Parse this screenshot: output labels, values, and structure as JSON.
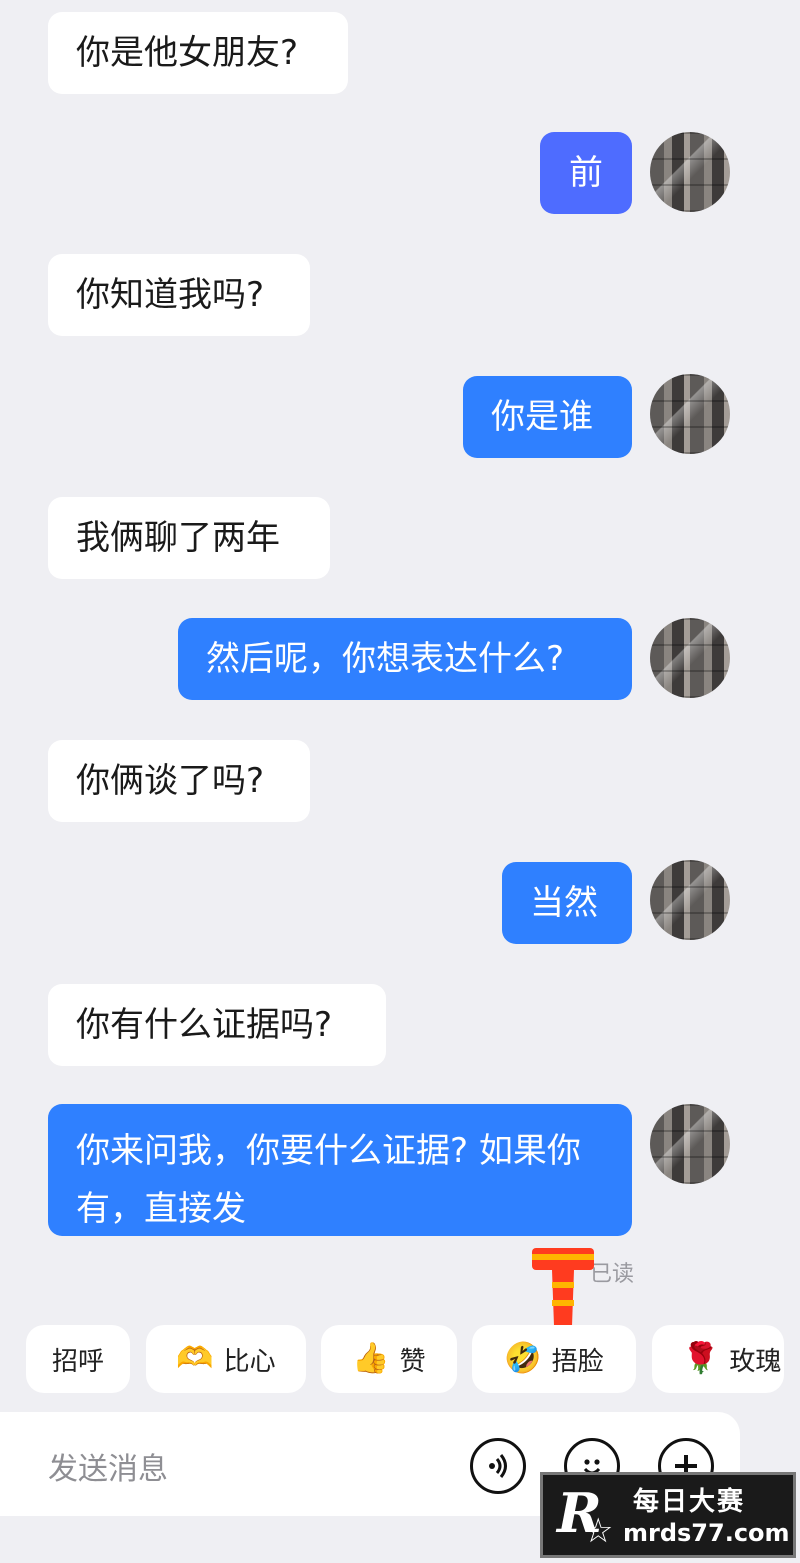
{
  "colors": {
    "background": "#efeff3",
    "incoming": "#ffffff",
    "outgoing": "#2f80ff",
    "outgoing_alt": "#4e6cff"
  },
  "messages": [
    {
      "side": "in",
      "text": "你是他女朋友?"
    },
    {
      "side": "out",
      "text": "前"
    },
    {
      "side": "in",
      "text": "你知道我吗?"
    },
    {
      "side": "out",
      "text": "你是谁"
    },
    {
      "side": "in",
      "text": "我俩聊了两年"
    },
    {
      "side": "out",
      "text": "然后呢，你想表达什么?"
    },
    {
      "side": "in",
      "text": "你俩谈了吗?"
    },
    {
      "side": "out",
      "text": "当然"
    },
    {
      "side": "in",
      "text": "你有什么证据吗?"
    },
    {
      "side": "out",
      "text": "你来问我，你要什么证据? 如果你有，直接发"
    }
  ],
  "status": {
    "read_label": "已读"
  },
  "quick_replies": [
    {
      "label": "招呼",
      "icon": "wave-icon"
    },
    {
      "label": "比心",
      "icon": "heart-hands-icon"
    },
    {
      "label": "赞",
      "icon": "thumbs-up-icon"
    },
    {
      "label": "捂脸",
      "icon": "facepalm-laugh-icon"
    },
    {
      "label": "玫瑰",
      "icon": "rose-icon"
    }
  ],
  "composer": {
    "placeholder": "发送消息",
    "voice_icon": "voice-icon",
    "emoji_icon": "emoji-icon",
    "plus_icon": "plus-icon"
  },
  "watermark": {
    "cn": "每日大赛",
    "url": "mrds77.com",
    "logo": "R"
  }
}
